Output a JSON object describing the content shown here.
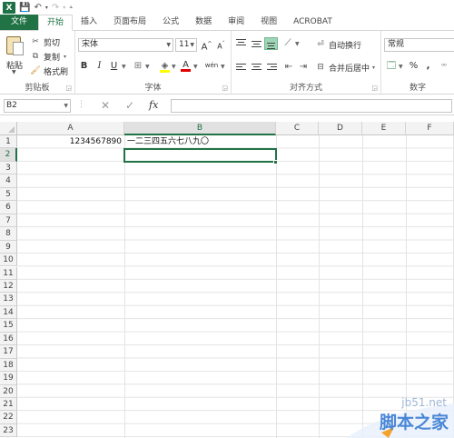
{
  "window": {
    "logo": "X"
  },
  "tabs": [
    "文件",
    "开始",
    "插入",
    "页面布局",
    "公式",
    "数据",
    "审阅",
    "视图",
    "ACROBAT"
  ],
  "ribbon": {
    "clipboard": {
      "paste": "粘贴",
      "cut": "剪切",
      "copy": "复制",
      "format_painter": "格式刷",
      "label": "剪贴板"
    },
    "font": {
      "name": "宋体",
      "size": "11",
      "grow": "A",
      "shrink": "A",
      "bold": "B",
      "italic": "I",
      "underline": "U",
      "fill": "A",
      "color": "A",
      "phonetic": "wén",
      "label": "字体"
    },
    "alignment": {
      "wrap": "自动换行",
      "merge": "合并后居中",
      "label": "对齐方式"
    },
    "number": {
      "format": "常规",
      "percent": "%",
      "comma": ",",
      "label": "数字"
    }
  },
  "formula_bar": {
    "name_box": "B2",
    "cancel": "✕",
    "enter": "✓",
    "fx": "fx",
    "value": ""
  },
  "sheet": {
    "columns": [
      "A",
      "B",
      "C",
      "D",
      "E",
      "F"
    ],
    "rows": [
      "1",
      "2",
      "3",
      "4",
      "5",
      "6",
      "7",
      "8",
      "9",
      "10",
      "11",
      "12",
      "13",
      "14",
      "15",
      "16",
      "17",
      "18",
      "19",
      "20",
      "21",
      "22",
      "23"
    ],
    "cells": {
      "A1": "1234567890",
      "B1": "一二三四五六七八九〇"
    },
    "selected": "B2"
  },
  "watermark": {
    "site": "jb51.net",
    "name": "脚本之家"
  },
  "colors": {
    "accent": "#217346",
    "header_bg": "#f3f3f3",
    "grid": "#e4e4e4"
  }
}
